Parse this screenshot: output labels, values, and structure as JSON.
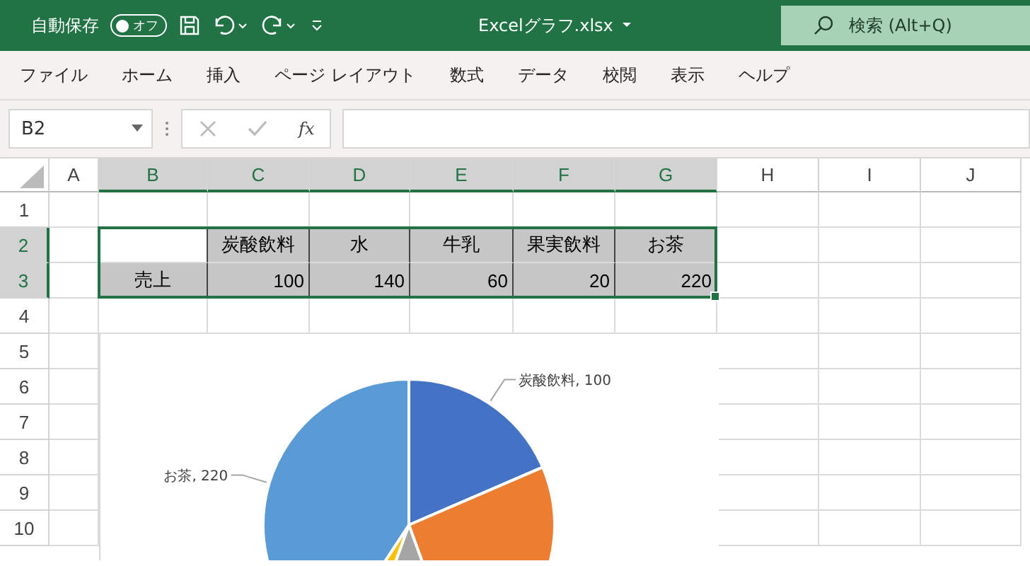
{
  "title_bar": {
    "autosave_label": "自動保存",
    "autosave_toggle": {
      "on": false,
      "text": "オフ"
    },
    "file_name": "Excelグラフ.xlsx",
    "search": {
      "placeholder": "検索 (Alt+Q)"
    }
  },
  "menu": [
    "ファイル",
    "ホーム",
    "挿入",
    "ページ レイアウト",
    "数式",
    "データ",
    "校閲",
    "表示",
    "ヘルプ"
  ],
  "formula_bar": {
    "name_box": "B2",
    "fx": "fx"
  },
  "sheet": {
    "columns": [
      {
        "label": "A",
        "selected": false
      },
      {
        "label": "B",
        "selected": true
      },
      {
        "label": "C",
        "selected": true
      },
      {
        "label": "D",
        "selected": true
      },
      {
        "label": "E",
        "selected": true
      },
      {
        "label": "F",
        "selected": true
      },
      {
        "label": "G",
        "selected": true
      },
      {
        "label": "H",
        "selected": false
      },
      {
        "label": "I",
        "selected": false
      },
      {
        "label": "J",
        "selected": false
      }
    ],
    "rows": [
      {
        "label": "1",
        "selected": false
      },
      {
        "label": "2",
        "selected": true
      },
      {
        "label": "3",
        "selected": true
      },
      {
        "label": "4",
        "selected": false
      },
      {
        "label": "5",
        "selected": false
      },
      {
        "label": "6",
        "selected": false
      },
      {
        "label": "7",
        "selected": false
      },
      {
        "label": "8",
        "selected": false
      },
      {
        "label": "9",
        "selected": false
      },
      {
        "label": "10",
        "selected": false
      }
    ],
    "table": {
      "headers": [
        "炭酸飲料",
        "水",
        "牛乳",
        "果実飲料",
        "お茶"
      ],
      "row_label": "売上",
      "values": [
        "100",
        "140",
        "60",
        "20",
        "220"
      ]
    }
  },
  "chart": {
    "slices": [
      {
        "color": "#4472c4"
      },
      {
        "color": "#ed7d31"
      },
      {
        "color": "#a5a5a5"
      },
      {
        "color": "#ffc000"
      },
      {
        "color": "#5b9bd5"
      }
    ],
    "labels": [
      "炭酸飲料, 100",
      "お茶, 220"
    ]
  }
}
